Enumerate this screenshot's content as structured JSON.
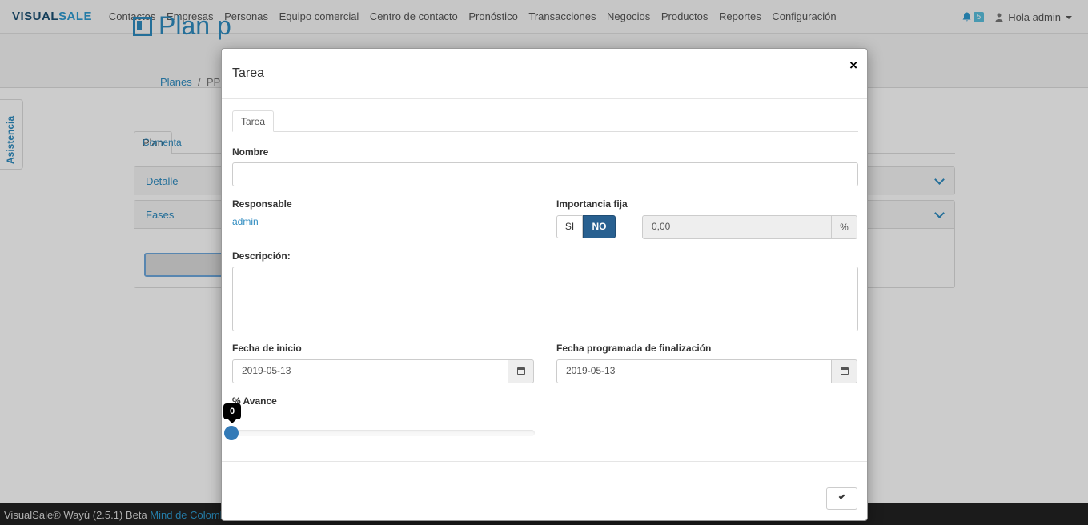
{
  "brand": {
    "part1": "VISUAL",
    "part2": "SALE"
  },
  "nav": {
    "items": [
      "Contactos",
      "Empresas",
      "Personas",
      "Equipo comercial",
      "Centro de contacto",
      "Pronóstico",
      "Transacciones",
      "Negocios",
      "Productos",
      "Reportes",
      "Configuración"
    ],
    "notifications": "5",
    "user": "Hola admin"
  },
  "page": {
    "title": "Plan p",
    "breadcrumb": {
      "root": "Planes",
      "current": "PPl"
    }
  },
  "side_tab": "Asistencia",
  "bg_tabs": {
    "plan": "Plan",
    "comments": "Comenta"
  },
  "bg_panels": {
    "detail": "Detalle",
    "phases": "Fases"
  },
  "footer": {
    "text": "VisualSale® Wayú (2.5.1) Beta ",
    "link": "Mind de Colombia"
  },
  "modal": {
    "title": "Tarea",
    "close": "×",
    "tab": "Tarea",
    "nombre_label": "Nombre",
    "nombre_value": "",
    "responsable_label": "Responsable",
    "responsable_value": "admin",
    "importancia_label": "Importancia fija",
    "toggle_si": "SI",
    "toggle_no": "NO",
    "importancia_value": "0,00",
    "percent": "%",
    "descripcion_label": "Descripción:",
    "descripcion_value": "",
    "fecha_inicio_label": "Fecha de inicio",
    "fecha_inicio_value": "2019-05-13",
    "fecha_fin_label": "Fecha programada de finalización",
    "fecha_fin_value": "2019-05-13",
    "avance_label": "% Avance",
    "avance_value": "0"
  },
  "colors": {
    "accent": "#2e8bc0",
    "toggle_active": "#286090",
    "slider": "#337ab7"
  }
}
